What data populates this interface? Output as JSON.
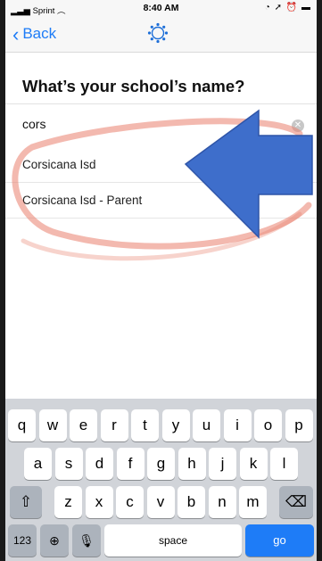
{
  "status_bar": {
    "carrier": "Sprint",
    "time": "8:40 AM"
  },
  "nav": {
    "back_label": "Back"
  },
  "page": {
    "title": "What’s your school’s name?"
  },
  "search": {
    "value": "cors"
  },
  "results": [
    "Corsicana Isd",
    "Corsicana Isd - Parent"
  ],
  "keyboard": {
    "row1": [
      "q",
      "w",
      "e",
      "r",
      "t",
      "y",
      "u",
      "i",
      "o",
      "p"
    ],
    "row2": [
      "a",
      "s",
      "d",
      "f",
      "g",
      "h",
      "j",
      "k",
      "l"
    ],
    "row3": [
      "z",
      "x",
      "c",
      "v",
      "b",
      "n",
      "m"
    ],
    "numbers_label": "123",
    "space_label": "space",
    "go_label": "go"
  },
  "colors": {
    "accent": "#1e7cf7",
    "arrow": "#3e6ecb",
    "annotation": "#e9806e"
  }
}
